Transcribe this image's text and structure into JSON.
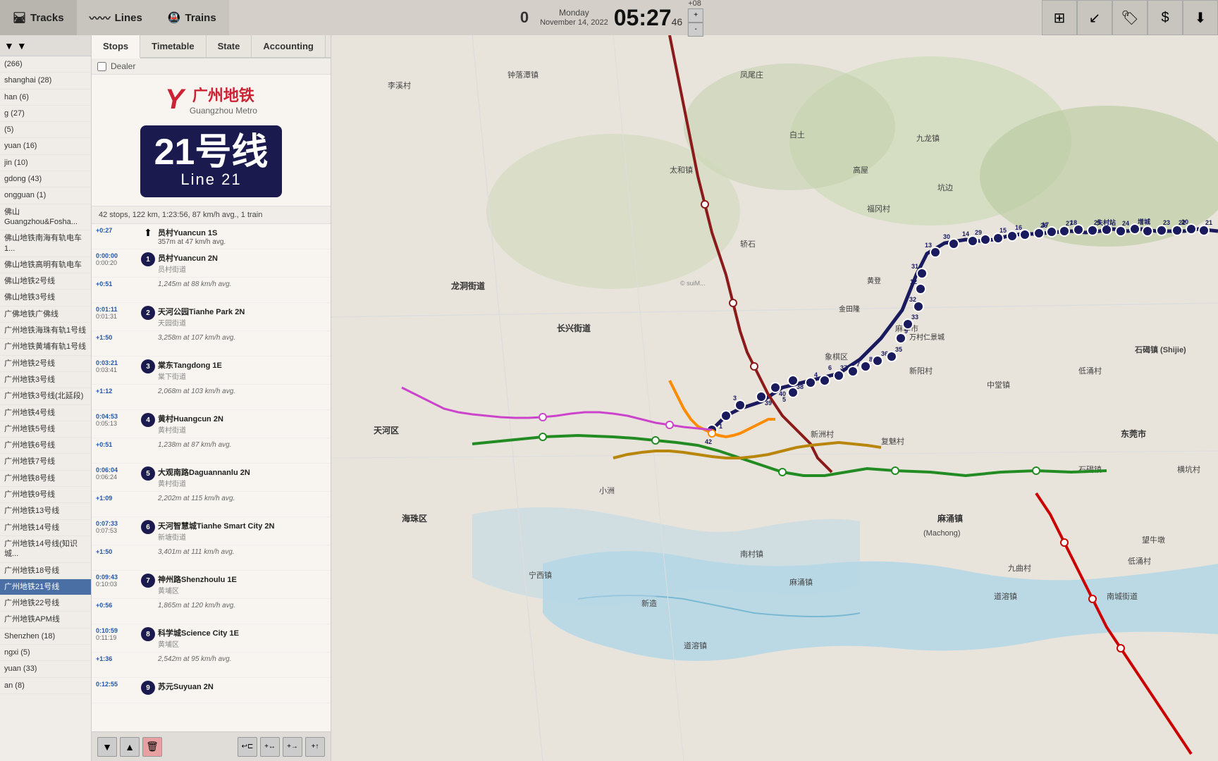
{
  "topbar": {
    "tracks_label": "Tracks",
    "lines_label": "Lines",
    "trains_label": "Trains",
    "train_count": "0",
    "day": "Monday",
    "date": "November 14, 2022",
    "time": "05:27",
    "seconds": "46",
    "timezone": "+08",
    "icons": [
      "⊞",
      "↙",
      "🏷",
      "$",
      "⬇"
    ]
  },
  "sidebar": {
    "filter_icon": "▼",
    "filter_icon2": "▼",
    "items": [
      {
        "label": "(266)",
        "id": "s1"
      },
      {
        "label": "shanghai (28)",
        "id": "s2"
      },
      {
        "label": "han (6)",
        "id": "s3"
      },
      {
        "label": "g (27)",
        "id": "s4"
      },
      {
        "label": "(5)",
        "id": "s5"
      },
      {
        "label": "yuan (16)",
        "id": "s6"
      },
      {
        "label": "jin (10)",
        "id": "s7"
      },
      {
        "label": "gdong (43)",
        "id": "s8"
      },
      {
        "label": "ongguan (1)",
        "id": "s9"
      },
      {
        "label": "佛山Guangzhou&Fosha...",
        "id": "s10"
      },
      {
        "label": "佛山地铁南海有轨电车1...",
        "id": "s11"
      },
      {
        "label": "佛山地铁高明有轨电车",
        "id": "s12"
      },
      {
        "label": "佛山地铁2号线",
        "id": "s13"
      },
      {
        "label": "佛山地铁3号线",
        "id": "s14"
      },
      {
        "label": "广佛地铁广佛线",
        "id": "s15"
      },
      {
        "label": "广州地铁海珠有轨1号线",
        "id": "s16"
      },
      {
        "label": "广州地铁黄埔有轨1号线",
        "id": "s17"
      },
      {
        "label": "广州地铁2号线",
        "id": "s18"
      },
      {
        "label": "广州地铁3号线",
        "id": "s19"
      },
      {
        "label": "广州地铁3号线(北延段)",
        "id": "s20"
      },
      {
        "label": "广州地铁4号线",
        "id": "s21"
      },
      {
        "label": "广州地铁5号线",
        "id": "s22"
      },
      {
        "label": "广州地铁6号线",
        "id": "s23"
      },
      {
        "label": "广州地铁7号线",
        "id": "s24"
      },
      {
        "label": "广州地铁8号线",
        "id": "s25"
      },
      {
        "label": "广州地铁9号线",
        "id": "s26"
      },
      {
        "label": "广州地铁13号线",
        "id": "s27"
      },
      {
        "label": "广州地铁14号线",
        "id": "s28"
      },
      {
        "label": "广州地铁14号线(知识城...",
        "id": "s29"
      },
      {
        "label": "广州地铁18号线",
        "id": "s30"
      },
      {
        "label": "广州地铁21号线",
        "id": "s31",
        "active": true
      },
      {
        "label": "广州地铁22号线",
        "id": "s32"
      },
      {
        "label": "广州地铁APM线",
        "id": "s33"
      },
      {
        "label": "Shenzhen (18)",
        "id": "s34"
      },
      {
        "label": "ngxi (5)",
        "id": "s35"
      },
      {
        "label": "yuan (33)",
        "id": "s36"
      },
      {
        "label": "an (8)",
        "id": "s37"
      }
    ]
  },
  "subtabs": {
    "tabs": [
      "Stops",
      "Timetable",
      "State",
      "Accounting"
    ],
    "active": "Stops"
  },
  "line_header": {
    "logo_icon": "Y",
    "logo_text": "广州地铁",
    "logo_sub": "Guangzhou Metro",
    "line_number": "21号线",
    "line_name": "Line  21"
  },
  "line_stats": {
    "text": "42 stops, 122 km, 1:23:56, 87 km/h avg., 1 train"
  },
  "stops": [
    {
      "num": "",
      "name": "员村Yuancun 1S",
      "sub": "",
      "dist": "357m at 47 km/h avg.",
      "delta": "+0:27",
      "arr": "",
      "dep": "",
      "highlight": false,
      "is_header": true
    },
    {
      "num": "1",
      "name": "员村Yuancun 2N",
      "sub": "员村街道",
      "dist": "",
      "delta": "0:00:00",
      "arr": "0:00:20",
      "highlight": false
    },
    {
      "num": "",
      "name": "1,245m at 88 km/h avg.",
      "sub": "",
      "dist": "",
      "delta": "+0:51",
      "arr": "",
      "highlight": false,
      "is_dist": true
    },
    {
      "num": "2",
      "name": "天河公园Tianhe Park 2N",
      "sub": "天园街道",
      "dist": "",
      "delta": "0:01:11",
      "arr": "0:01:31",
      "highlight": false
    },
    {
      "num": "",
      "name": "3,258m at 107 km/h avg.",
      "sub": "",
      "dist": "",
      "delta": "+1:50",
      "arr": "",
      "highlight": false,
      "is_dist": true
    },
    {
      "num": "3",
      "name": "棠东Tangdong 1E",
      "sub": "棠下街道",
      "dist": "",
      "delta": "0:03:21",
      "arr": "0:03:41",
      "highlight": false
    },
    {
      "num": "",
      "name": "2,068m at 103 km/h avg.",
      "sub": "",
      "dist": "",
      "delta": "+1:12",
      "arr": "",
      "highlight": false,
      "is_dist": true
    },
    {
      "num": "4",
      "name": "黄村Huangcun 2N",
      "sub": "黄村街道",
      "dist": "",
      "delta": "0:04:53",
      "arr": "0:05:13",
      "highlight": false
    },
    {
      "num": "",
      "name": "1,238m at 87 km/h avg.",
      "sub": "",
      "dist": "",
      "delta": "+0:51",
      "arr": "",
      "highlight": false,
      "is_dist": true
    },
    {
      "num": "5",
      "name": "大观南路Daguannanlu 2N",
      "sub": "黄村街道",
      "dist": "",
      "delta": "0:06:04",
      "arr": "0:06:24",
      "highlight": false
    },
    {
      "num": "",
      "name": "2,202m at 115 km/h avg.",
      "sub": "",
      "dist": "",
      "delta": "+1:09",
      "arr": "",
      "highlight": false,
      "is_dist": true
    },
    {
      "num": "6",
      "name": "天河智慧城Tianhe Smart City 2N",
      "sub": "新塘街道",
      "dist": "",
      "delta": "0:07:33",
      "arr": "0:07:53",
      "highlight": false
    },
    {
      "num": "",
      "name": "3,401m at 111 km/h avg.",
      "sub": "",
      "dist": "",
      "delta": "+1:50",
      "arr": "",
      "highlight": false,
      "is_dist": true
    },
    {
      "num": "7",
      "name": "神州路Shenzhoulu 1E",
      "sub": "黄埔区",
      "dist": "",
      "delta": "0:09:43",
      "arr": "0:10:03",
      "highlight": false
    },
    {
      "num": "",
      "name": "1,865m at 120 km/h avg.",
      "sub": "",
      "dist": "",
      "delta": "+0:56",
      "arr": "",
      "highlight": false,
      "is_dist": true
    },
    {
      "num": "8",
      "name": "科学城Science City 1E",
      "sub": "黄埔区",
      "dist": "",
      "delta": "0:10:59",
      "arr": "0:11:19",
      "highlight": false
    },
    {
      "num": "",
      "name": "2,542m at 95 km/h avg.",
      "sub": "",
      "dist": "",
      "delta": "+1:36",
      "arr": "",
      "highlight": false,
      "is_dist": true
    },
    {
      "num": "9",
      "name": "苏元Suyuan 2N",
      "sub": "",
      "dist": "",
      "delta": "0:12:55",
      "arr": "",
      "highlight": false
    }
  ],
  "panel_bottom": {
    "nav_prev": "▼",
    "nav_next": "▲",
    "delete": "🗑",
    "btn1": "↩⊏",
    "btn2": "+↔",
    "btn3": "+→",
    "btn4": "+↑"
  }
}
